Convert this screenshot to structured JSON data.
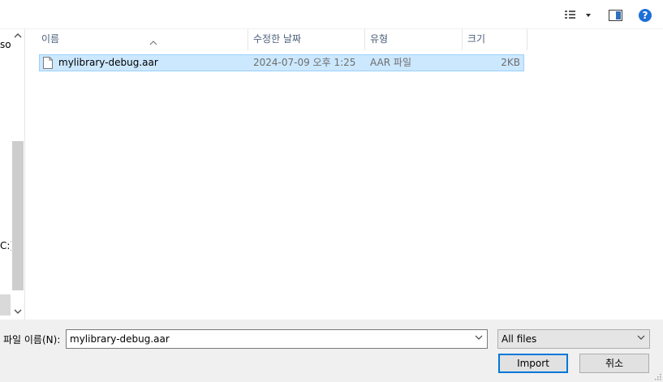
{
  "nav_pane": {
    "partial_items": [
      "soı",
      "C:)"
    ]
  },
  "columns": {
    "name": "이름",
    "date": "수정한 날짜",
    "type": "유형",
    "size": "크기"
  },
  "files": [
    {
      "name": "mylibrary-debug.aar",
      "date": "2024-07-09 오후 1:25",
      "type": "AAR 파일",
      "size": "2KB",
      "selected": true
    }
  ],
  "footer": {
    "filename_label": "파일 이름(N):",
    "filename_value": "mylibrary-debug.aar",
    "filter_value": "All files",
    "import_label": "Import",
    "cancel_label": "취소"
  },
  "toolbar": {
    "help_glyph": "?"
  },
  "colors": {
    "selection_bg": "#cce8ff",
    "selection_border": "#99d1ff",
    "header_text": "#4c607a",
    "default_button_border": "#0078d7",
    "help_icon": "#1d6fd8"
  }
}
